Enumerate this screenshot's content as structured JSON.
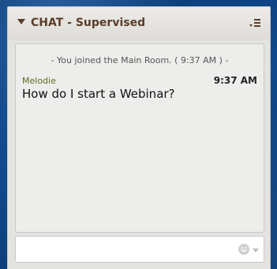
{
  "chat_panel": {
    "title": "CHAT - Supervised",
    "colors": {
      "title": "#5a3d2a",
      "sender": "#5f6a1e",
      "panel_bg": "#e3e3e1"
    },
    "messages": [
      {
        "type": "system",
        "text": "- You joined the Main Room. ( 9:37 AM ) -"
      },
      {
        "type": "user",
        "sender": "Melodie",
        "time": "9:37 AM",
        "text": "How do I start a Webinar?"
      }
    ],
    "input": {
      "value": "",
      "placeholder": ""
    },
    "icons": {
      "collapse": "collapse-triangle-icon",
      "menu": "options-menu-icon",
      "emoji": "emoji-icon"
    }
  }
}
